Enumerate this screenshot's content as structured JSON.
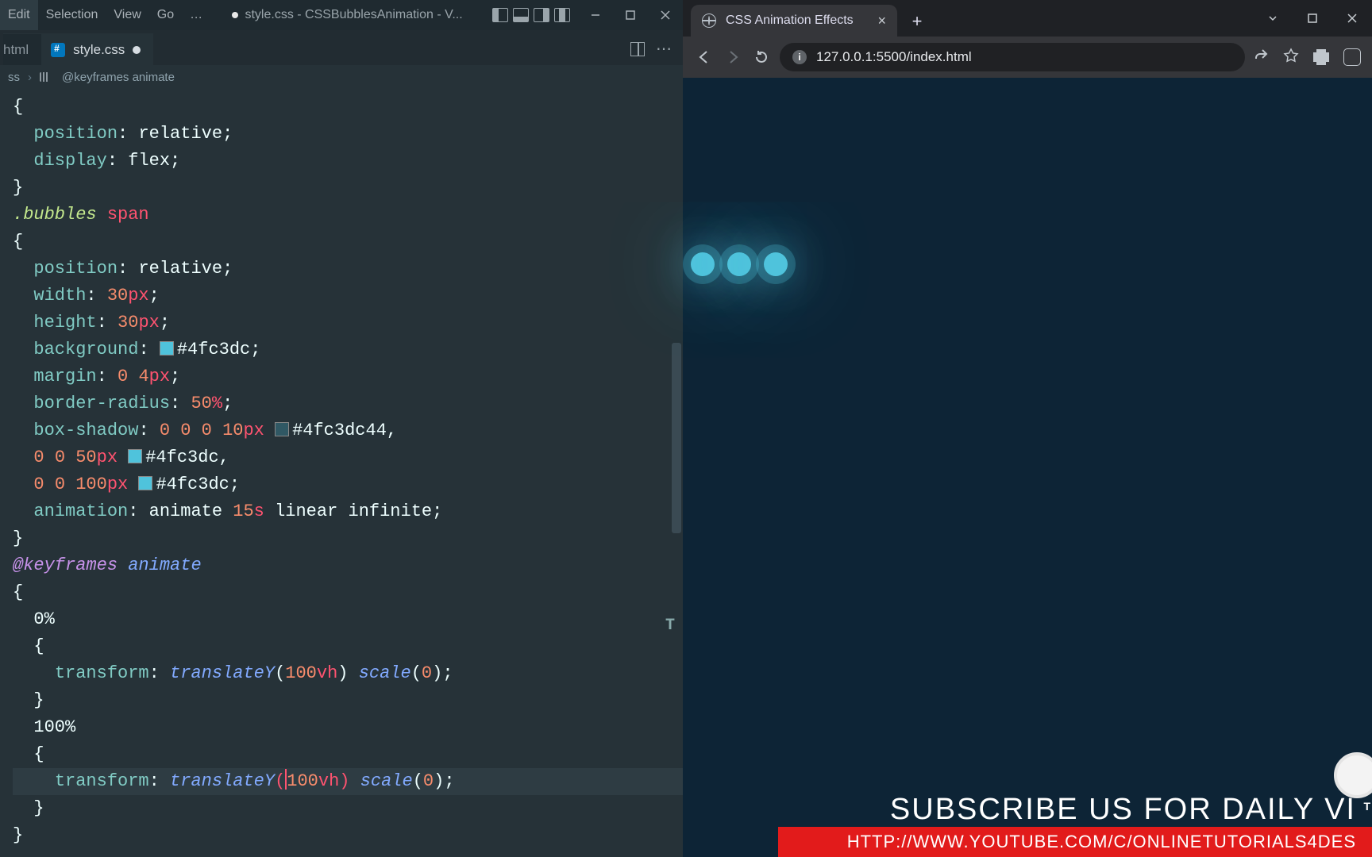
{
  "vscode": {
    "menu": [
      "Edit",
      "Selection",
      "View",
      "Go",
      "…"
    ],
    "window_title": "style.css - CSSBubblesAnimation - V...",
    "tabs": {
      "first_partial": "html",
      "active_name": "style.css"
    },
    "breadcrumb": {
      "file_label": "ss",
      "sep": "›",
      "symbol": "@keyframes animate"
    },
    "code": {
      "l1": "{",
      "l2_prop": "position",
      "l2_val": "relative",
      "l3_prop": "display",
      "l3_val": "flex",
      "l4": "}",
      "l5_sel1": ".bubbles",
      "l5_sel2": "span",
      "l6": "{",
      "l7_prop": "position",
      "l7_val": "relative",
      "l8_prop": "width",
      "l8_num": "30",
      "l8_unit": "px",
      "l9_prop": "height",
      "l9_num": "30",
      "l9_unit": "px",
      "l10_prop": "background",
      "l10_hex": "#4fc3dc",
      "l11_prop": "margin",
      "l11_a": "0",
      "l11_b": "4",
      "l11_unit": "px",
      "l12_prop": "border-radius",
      "l12_num": "50",
      "l12_unit": "%",
      "l13_prop": "box-shadow",
      "l13_z": "0",
      "l13_n": "10",
      "l13_u": "px",
      "l13_hex": "#4fc3dc44",
      "l14_z": "0",
      "l14_n": "50",
      "l14_u": "px",
      "l14_hex": "#4fc3dc",
      "l15_z": "0",
      "l15_n": "100",
      "l15_u": "px",
      "l15_hex": "#4fc3dc",
      "l16_prop": "animation",
      "l16_name": "animate",
      "l16_dur": "15",
      "l16_du": "s",
      "l16_tf": "linear",
      "l16_ic": "infinite",
      "l17": "}",
      "l18_at": "@keyframes",
      "l18_name": "animate",
      "l19": "{",
      "l20": "0%",
      "l21": "{",
      "l22_prop": "transform",
      "l22_fn1": "translateY",
      "l22_n1": "100",
      "l22_u1": "vh",
      "l22_fn2": "scale",
      "l22_n2": "0",
      "l23": "}",
      "l24": "100%",
      "l25": "{",
      "l26_prop": "transform",
      "l26_fn1": "translateY",
      "l26_n1": "100",
      "l26_u1": "vh",
      "l26_fn2": "scale",
      "l26_n2": "0",
      "l27": "}",
      "l28": "}"
    }
  },
  "browser": {
    "tab_title": "CSS Animation Effects",
    "url": "127.0.0.1:5500/index.html"
  },
  "overlay": {
    "subscribe": "SUBSCRIBE US FOR DAILY VI",
    "url": "HTTP://WWW.YOUTUBE.COM/C/ONLINETUTORIALS4DES",
    "t": "T"
  },
  "colors": {
    "bubble": "#4fc3dc",
    "bubble_shadow": "#4fc3dc44"
  }
}
